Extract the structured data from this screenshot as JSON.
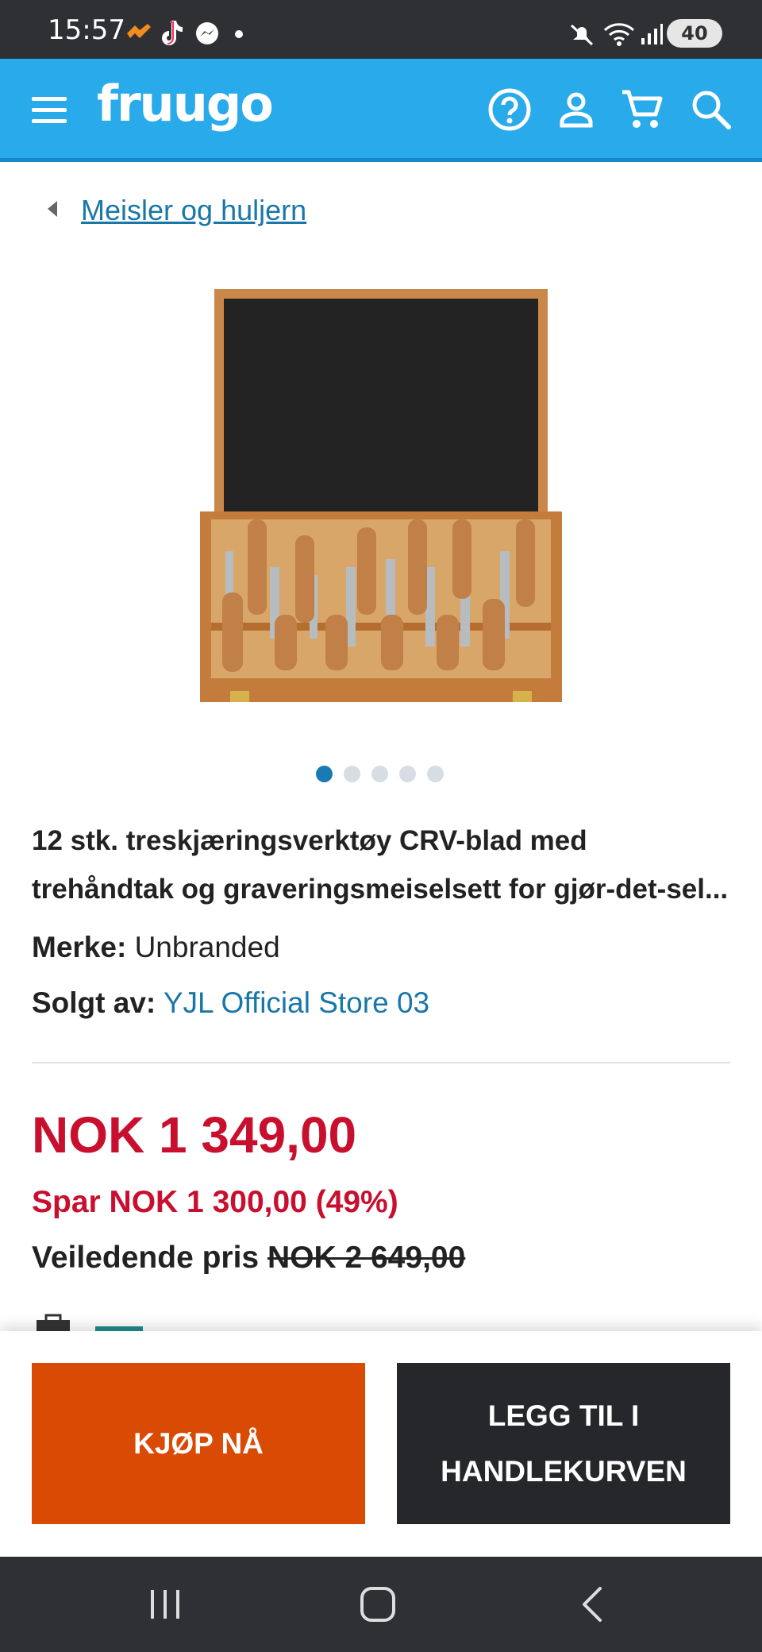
{
  "status_bar": {
    "time": "15:57",
    "battery": "40",
    "icons": [
      "orange-app-icon",
      "tiktok-icon",
      "messenger-icon",
      "dot-icon",
      "mute-icon",
      "wifi-icon",
      "signal-icon"
    ]
  },
  "header": {
    "logo": "fruugo",
    "icons": [
      "menu-icon",
      "help-icon",
      "account-icon",
      "cart-icon",
      "search-icon"
    ],
    "color": "#29aaea"
  },
  "breadcrumb": {
    "label": "Meisler og huljern"
  },
  "gallery": {
    "image_count": 5,
    "active_index": 0
  },
  "product": {
    "title_line1": "12 stk. treskjæringsverktøy CRV-blad med",
    "title_line2": "trehåndtak og graveringsmeiselsett for gjør-det-sel...",
    "brand_label": "Merke:",
    "brand_value": "Unbranded",
    "seller_label": "Solgt av:",
    "seller_value": "YJL Official Store 03"
  },
  "pricing": {
    "price": "NOK 1 349,00",
    "savings": "Spar NOK 1 300,00 (49%)",
    "rrp_label": "Veiledende pris",
    "rrp_value": "NOK 2 649,00",
    "price_color": "#c8102e"
  },
  "actions": {
    "buy_now": "KJØP NÅ",
    "add_to_cart": "LEGG TIL I HANDLEKURVEN",
    "buy_color": "#d94a04",
    "cart_color": "#25272b"
  },
  "nav_bar": {
    "icons": [
      "recent-apps-icon",
      "home-icon",
      "back-icon"
    ]
  }
}
